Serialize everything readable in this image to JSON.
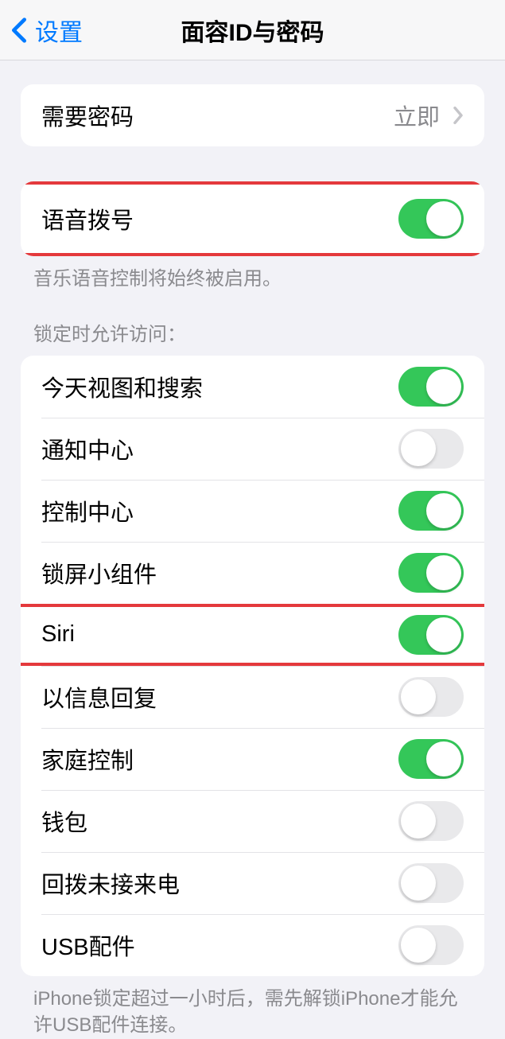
{
  "nav": {
    "back_label": "设置",
    "title": "面容ID与密码"
  },
  "require_passcode": {
    "label": "需要密码",
    "value": "立即"
  },
  "voice_dial": {
    "label": "语音拨号",
    "enabled": true,
    "footer": "音乐语音控制将始终被启用。"
  },
  "allow_access": {
    "header": "锁定时允许访问：",
    "items": [
      {
        "label": "今天视图和搜索",
        "enabled": true
      },
      {
        "label": "通知中心",
        "enabled": false
      },
      {
        "label": "控制中心",
        "enabled": true
      },
      {
        "label": "锁屏小组件",
        "enabled": true
      },
      {
        "label": "Siri",
        "enabled": true
      },
      {
        "label": "以信息回复",
        "enabled": false
      },
      {
        "label": "家庭控制",
        "enabled": true
      },
      {
        "label": "钱包",
        "enabled": false
      },
      {
        "label": "回拨未接来电",
        "enabled": false
      },
      {
        "label": "USB配件",
        "enabled": false
      }
    ],
    "footer": "iPhone锁定超过一小时后，需先解锁iPhone才能允许USB配件连接。"
  },
  "highlights": {
    "voice_dial_group": true,
    "siri_row_index": 4
  }
}
